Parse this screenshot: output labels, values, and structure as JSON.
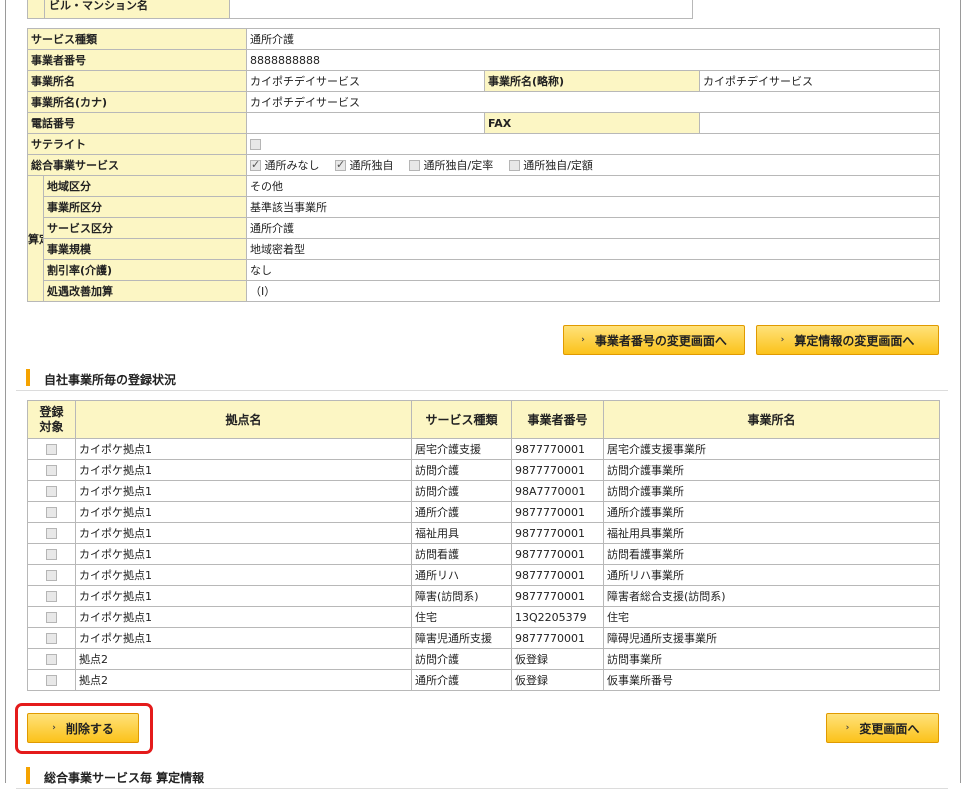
{
  "top_row_label": "ビル・マンション名",
  "info": {
    "service_type": {
      "label": "サービス種類",
      "value": "通所介護"
    },
    "business_number": {
      "label": "事業者番号",
      "value": "8888888888"
    },
    "office_name": {
      "label": "事業所名",
      "value": "カイポチデイサービス"
    },
    "office_short": {
      "label": "事業所名(略称)",
      "value": "カイポチデイサービス"
    },
    "office_kana": {
      "label": "事業所名(カナ)",
      "value": "カイポチデイサービス"
    },
    "phone": {
      "label": "電話番号",
      "value": ""
    },
    "fax": {
      "label": "FAX",
      "value": ""
    },
    "satellite": {
      "label": "サテライト"
    },
    "sogo": {
      "label": "総合事業サービス",
      "options": [
        {
          "label": "通所みなし",
          "checked": true
        },
        {
          "label": "通所独自",
          "checked": true
        },
        {
          "label": "通所独自/定率",
          "checked": false
        },
        {
          "label": "通所独自/定額",
          "checked": false
        }
      ]
    },
    "santei_label": "算定",
    "area": {
      "label": "地域区分",
      "value": "その他"
    },
    "office_cat": {
      "label": "事業所区分",
      "value": "基準該当事業所"
    },
    "service_cat": {
      "label": "サービス区分",
      "value": "通所介護"
    },
    "scale": {
      "label": "事業規模",
      "value": "地域密着型"
    },
    "discount": {
      "label": "割引率(介護)",
      "value": "なし"
    },
    "treatment": {
      "label": "処遇改善加算",
      "value": "（Ⅰ）"
    }
  },
  "buttons": {
    "change_number": "事業者番号の変更画面へ",
    "change_santei": "算定情報の変更画面へ",
    "delete": "削除する",
    "change_screen": "変更画面へ"
  },
  "section1": "自社事業所毎の登録状況",
  "section2": "総合事業サービス毎 算定情報",
  "list": {
    "headers": [
      "登録対象",
      "拠点名",
      "サービス種類",
      "事業者番号",
      "事業所名"
    ],
    "rows": [
      [
        "カイポケ拠点1",
        "居宅介護支援",
        "9877770001",
        "居宅介護支援事業所"
      ],
      [
        "カイポケ拠点1",
        "訪問介護",
        "9877770001",
        "訪問介護事業所"
      ],
      [
        "カイポケ拠点1",
        "訪問介護",
        "98A7770001",
        "訪問介護事業所"
      ],
      [
        "カイポケ拠点1",
        "通所介護",
        "9877770001",
        "通所介護事業所"
      ],
      [
        "カイポケ拠点1",
        "福祉用具",
        "9877770001",
        "福祉用具事業所"
      ],
      [
        "カイポケ拠点1",
        "訪問看護",
        "9877770001",
        "訪問看護事業所"
      ],
      [
        "カイポケ拠点1",
        "通所リハ",
        "9877770001",
        "通所リハ事業所"
      ],
      [
        "カイポケ拠点1",
        "障害(訪問系)",
        "9877770001",
        "障害者総合支援(訪問系)"
      ],
      [
        "カイポケ拠点1",
        "住宅",
        "13Q2205379",
        "住宅"
      ],
      [
        "カイポケ拠点1",
        "障害児通所支援",
        "9877770001",
        "障碍児通所支援事業所"
      ],
      [
        "拠点2",
        "訪問介護",
        "仮登録",
        "訪問事業所"
      ],
      [
        "拠点2",
        "通所介護",
        "仮登録",
        "仮事業所番号"
      ]
    ]
  }
}
